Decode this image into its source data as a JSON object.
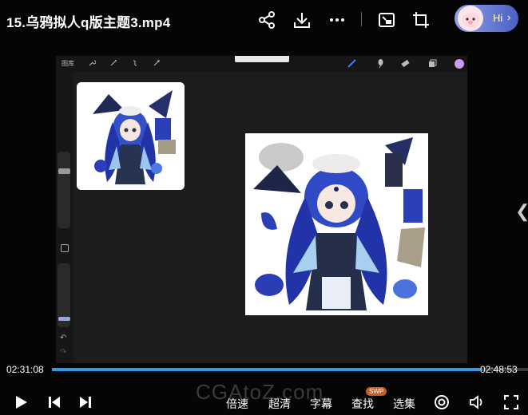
{
  "header": {
    "title": "15.乌鸦拟人q版主题3.mp4",
    "ai_button_label": "Hi",
    "ai_button_chevron": "›"
  },
  "video": {
    "canvas_label": "图库",
    "undo_glyph": "↶",
    "redo_glyph": "↷"
  },
  "player": {
    "current_time": "02:31:08",
    "total_time": "02:48:53",
    "progress_fraction": 0.9,
    "side_arrow": "❮",
    "controls": {
      "speed_label": "倍速",
      "quality_label": "超清",
      "subtitle_label": "字幕",
      "search_label": "查找",
      "search_badge": "SWP",
      "episodes_label": "选集"
    },
    "watermark": "CGAtoZ.com"
  },
  "colors": {
    "accent": "#2e9be6",
    "art_blue": "#2b3fb8"
  },
  "icons": [
    "share-icon",
    "download-icon",
    "more-icon",
    "picture-in-picture-icon",
    "crop-icon",
    "play-icon",
    "previous-icon",
    "next-icon",
    "danmaku-icon",
    "volume-icon",
    "fullscreen-icon"
  ]
}
